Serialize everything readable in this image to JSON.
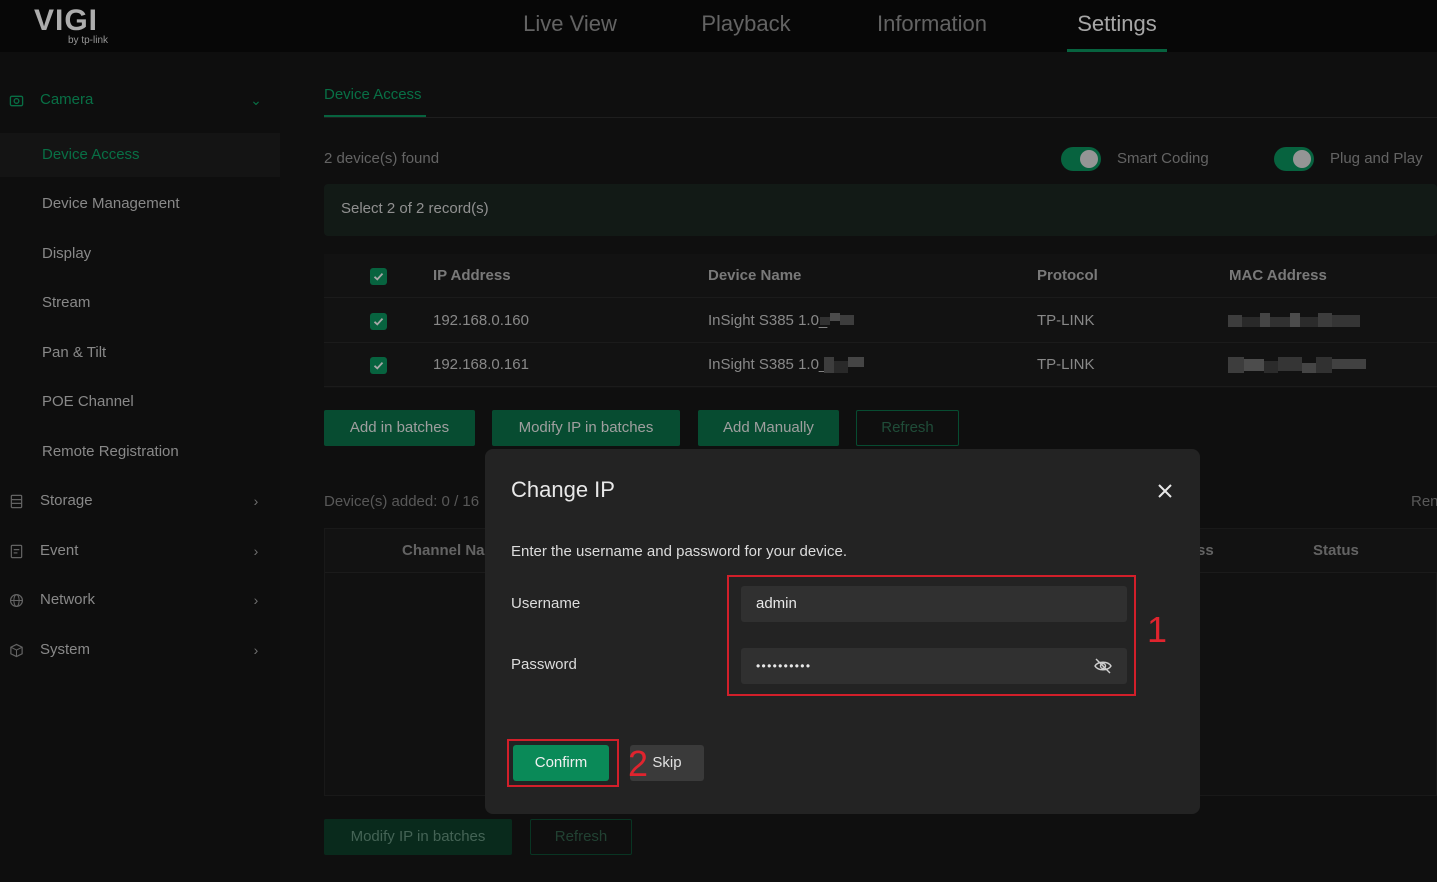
{
  "colors": {
    "accent": "#0a8a58",
    "highlight": "#d21f2a",
    "background": "#111111"
  },
  "logo": {
    "brand": "VIGI",
    "sub": "by tp-link"
  },
  "top_nav": {
    "tabs": [
      "Live View",
      "Playback",
      "Information",
      "Settings"
    ],
    "active": "Settings"
  },
  "sidebar": {
    "camera": {
      "label": "Camera",
      "icon": "camera-icon"
    },
    "camera_items": [
      "Device Access",
      "Device Management",
      "Display",
      "Stream",
      "Pan & Tilt",
      "POE Channel",
      "Remote Registration"
    ],
    "active_item": "Device Access",
    "groups": [
      {
        "label": "Storage",
        "icon": "storage-icon"
      },
      {
        "label": "Event",
        "icon": "event-icon"
      },
      {
        "label": "Network",
        "icon": "network-icon"
      },
      {
        "label": "System",
        "icon": "system-icon"
      }
    ]
  },
  "main": {
    "subtab": "Device Access",
    "found": "2 device(s) found",
    "smart_coding": "Smart Coding",
    "plug_and_play": "Plug and Play",
    "select_text": "Select 2 of 2 record(s)",
    "table": {
      "headers": [
        "IP Address",
        "Device Name",
        "Protocol",
        "MAC Address"
      ],
      "rows": [
        {
          "ip": "192.168.0.160",
          "name": "InSight S385 1.0_",
          "protocol": "TP-LINK"
        },
        {
          "ip": "192.168.0.161",
          "name": "InSight S385 1.0_",
          "protocol": "TP-LINK"
        }
      ]
    },
    "buttons": {
      "add_batches": "Add in batches",
      "modify_ip": "Modify IP in batches",
      "add_manually": "Add Manually",
      "refresh": "Refresh"
    },
    "added": "Device(s) added: 0 / 16",
    "remove_partial": "Ren",
    "table2_headers": {
      "channel": "Channel Na",
      "address_partial": "ss",
      "status": "Status"
    },
    "bottom_buttons": {
      "modify_ip": "Modify IP in batches",
      "refresh": "Refresh"
    }
  },
  "modal": {
    "title": "Change IP",
    "description": "Enter the username and password for your device.",
    "username_label": "Username",
    "username_value": "admin",
    "password_label": "Password",
    "password_value": "• • • • • • • • • •",
    "confirm": "Confirm",
    "skip": "Skip"
  },
  "annotations": {
    "step1": "1",
    "step2": "2"
  }
}
